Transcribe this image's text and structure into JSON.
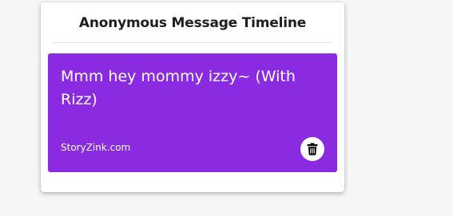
{
  "timeline": {
    "title": "Anonymous Message Timeline"
  },
  "message": {
    "text": "Mmm hey mommy izzy~ (With Rizz)",
    "source": "StoryZink.com",
    "background_color": "#8a2be2"
  },
  "icons": {
    "delete": "trash-icon"
  }
}
